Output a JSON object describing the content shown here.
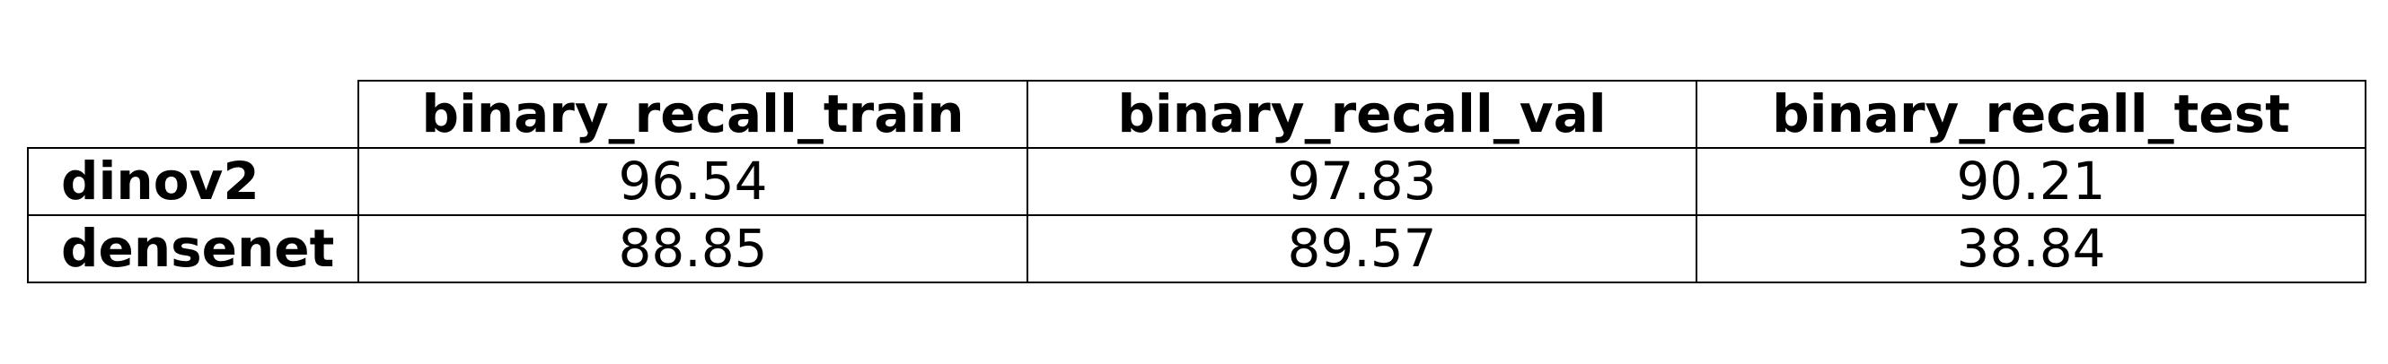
{
  "chart_data": {
    "type": "table",
    "columns": [
      "binary_recall_train",
      "binary_recall_val",
      "binary_recall_test"
    ],
    "rows": [
      {
        "label": "dinov2",
        "values": [
          "96.54",
          "97.83",
          "90.21"
        ]
      },
      {
        "label": "densenet",
        "values": [
          "88.85",
          "89.57",
          "38.84"
        ]
      }
    ]
  }
}
